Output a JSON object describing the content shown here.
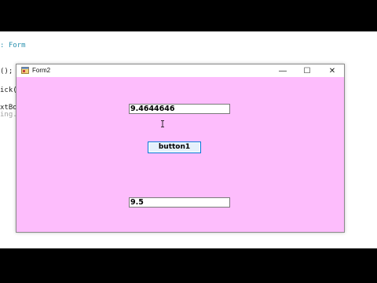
{
  "editor": {
    "lines": [
      ": Form",
      "();",
      "ick(",
      "xtBo",
      "ing."
    ]
  },
  "window": {
    "title": "Form2",
    "controls": {
      "minimize": "—",
      "maximize": "☐",
      "close": "✕"
    }
  },
  "form": {
    "background": "#fdbdfc",
    "textbox1_value": "9.4644646",
    "button1_label": "button1",
    "textbox2_value": "9.5"
  }
}
